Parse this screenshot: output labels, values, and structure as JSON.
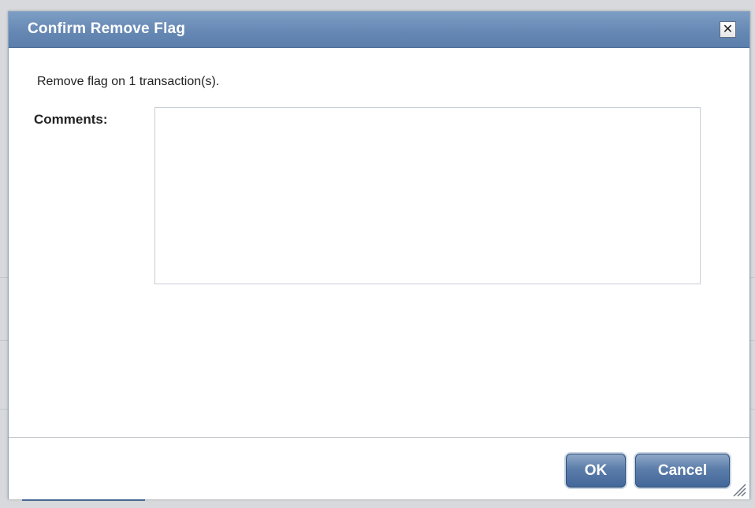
{
  "dialog": {
    "title": "Confirm Remove Flag",
    "close_glyph": "✕",
    "message": "Remove flag on 1 transaction(s).",
    "comments_label": "Comments:",
    "comments_value": "",
    "buttons": {
      "ok_label": "OK",
      "cancel_label": "Cancel"
    }
  },
  "icons": {
    "close": "close-icon",
    "resize": "resize-grip-icon"
  },
  "colors": {
    "titlebar": "#6688b4",
    "button": "#4f72a3",
    "dialog_bg": "#ffffff"
  }
}
